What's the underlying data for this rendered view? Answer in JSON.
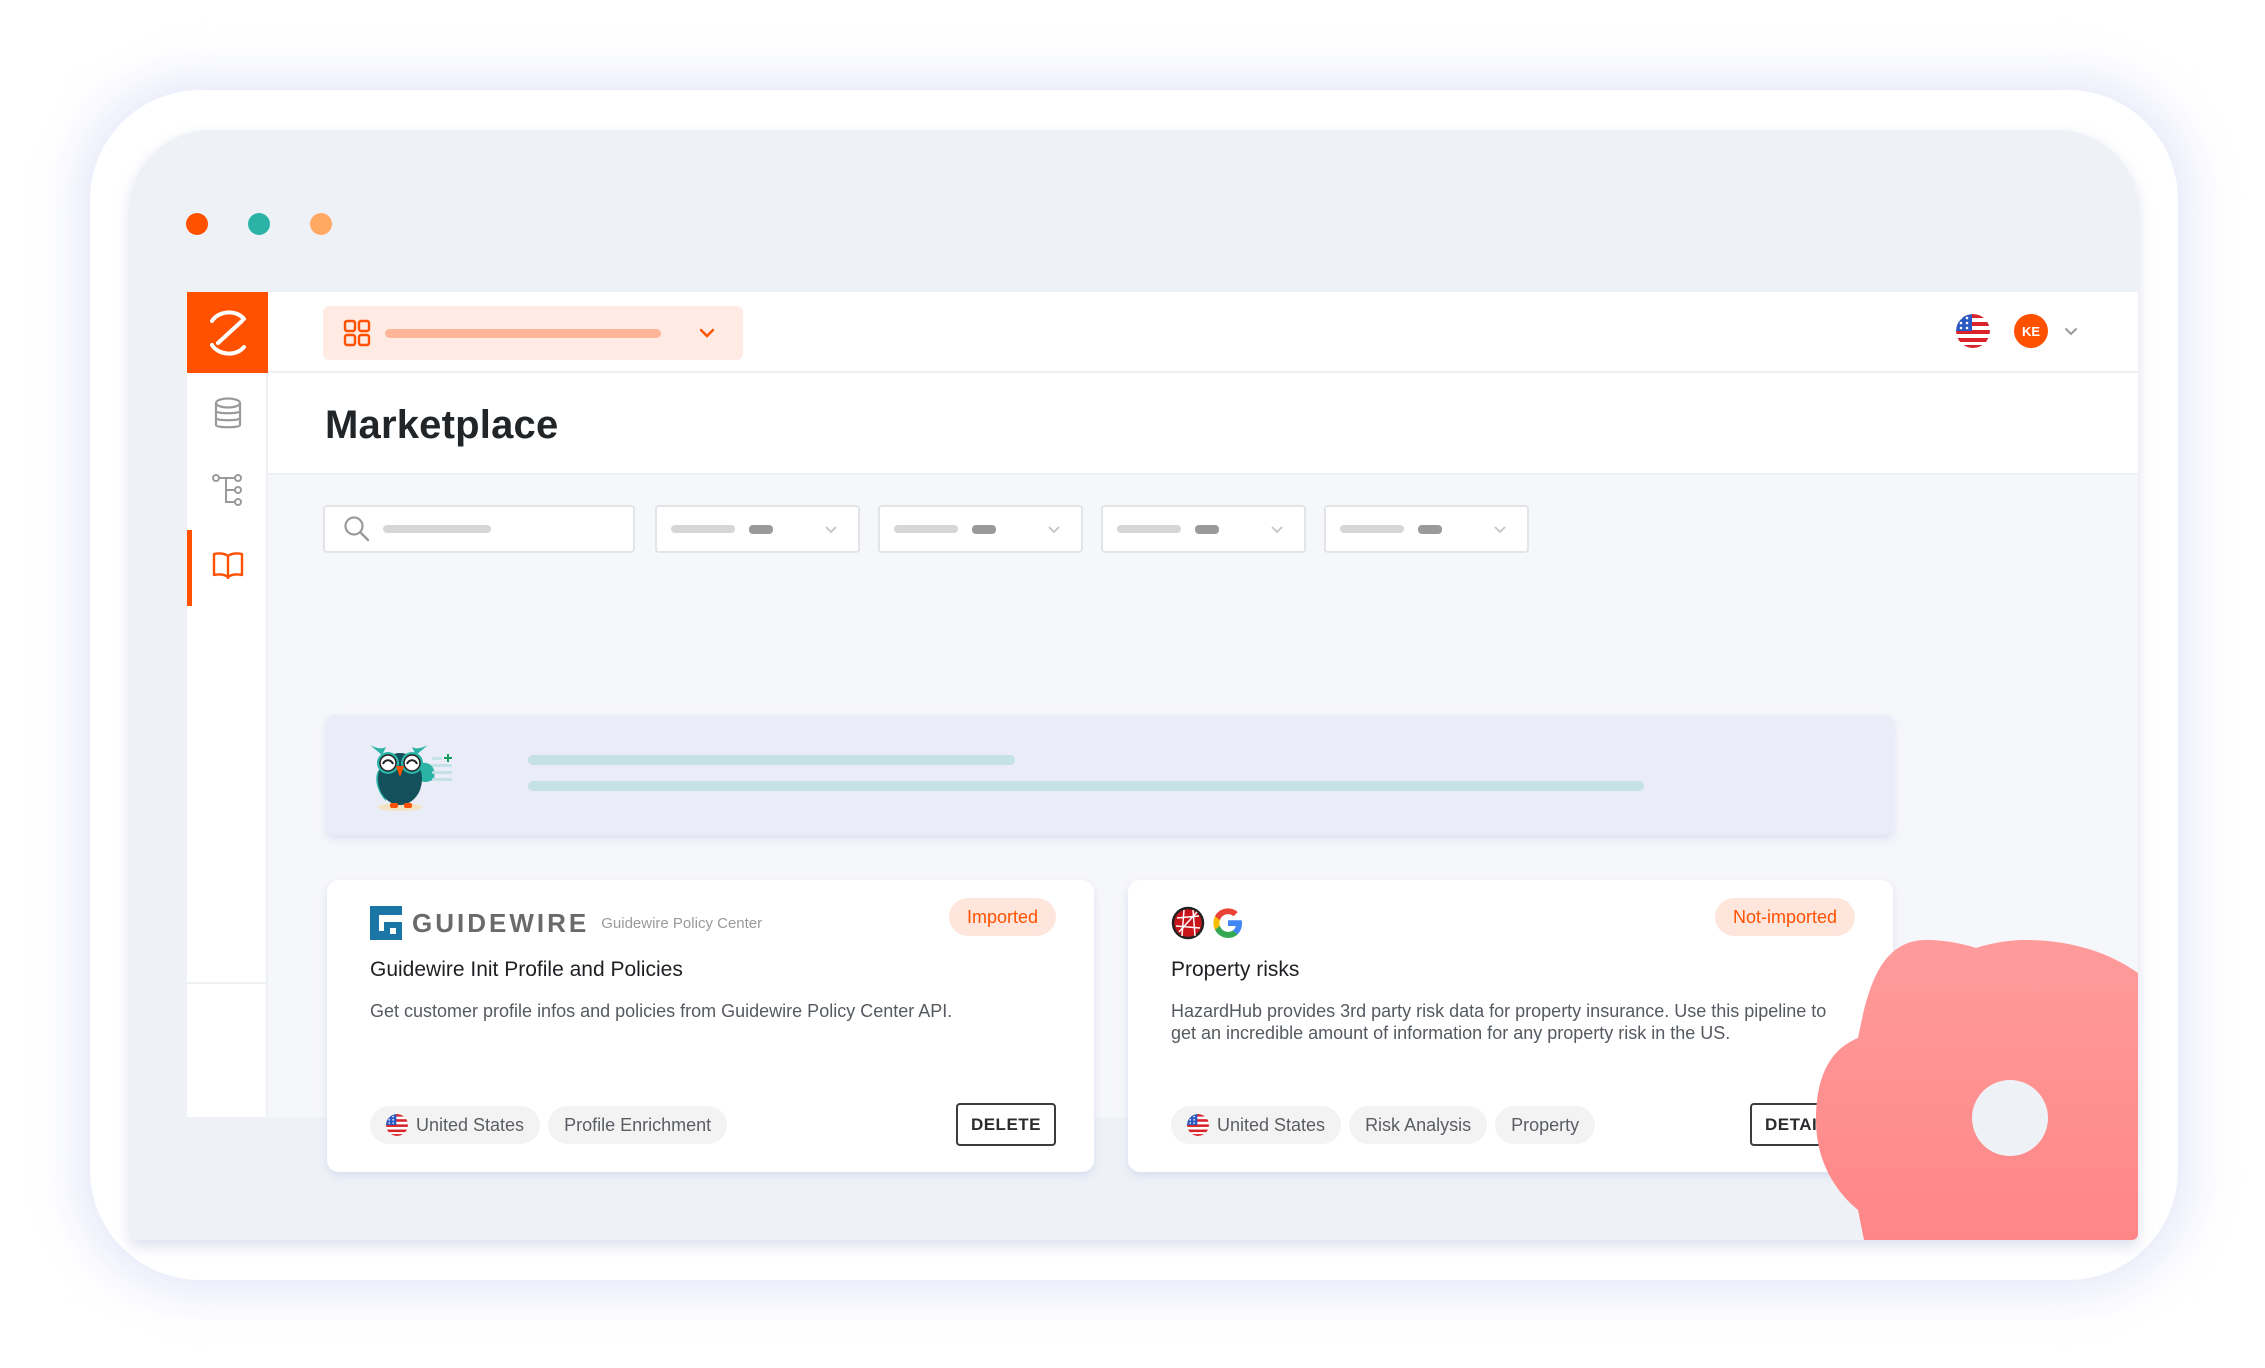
{
  "window": {
    "traffic_lights": [
      {
        "name": "close",
        "color": "#ff5100"
      },
      {
        "name": "minimize",
        "color": "#2bb3a6"
      },
      {
        "name": "maximize",
        "color": "#ffa963"
      }
    ]
  },
  "brand": {
    "accent": "#ff5100",
    "logo_icon": "zeta-logo-icon"
  },
  "sidebar": {
    "items": [
      {
        "id": "data",
        "icon": "database-icon",
        "active": false
      },
      {
        "id": "pipelines",
        "icon": "tree-icon",
        "active": false
      },
      {
        "id": "marketplace",
        "icon": "book-icon",
        "active": true
      }
    ]
  },
  "header": {
    "app_selector": {
      "icon": "grid-icon",
      "value": "",
      "chevron": "chevron-down-icon"
    },
    "language_flag": "us-flag-icon",
    "user": {
      "initials": "KE"
    }
  },
  "page": {
    "title": "Marketplace"
  },
  "filters": {
    "search": {
      "icon": "search-icon",
      "placeholder": ""
    },
    "dropdowns": [
      {
        "label": "",
        "value": ""
      },
      {
        "label": "",
        "value": ""
      },
      {
        "label": "",
        "value": ""
      },
      {
        "label": "",
        "value": ""
      }
    ]
  },
  "banner": {
    "illustration": "owl-mascot"
  },
  "cards": [
    {
      "logo_text": "GUIDEWIRE",
      "logo_subtext": "Guidewire Policy Center",
      "status": "Imported",
      "title": "Guidewire Init Profile and Policies",
      "description": "Get customer profile infos and policies from Guidewire Policy Center API.",
      "tags": [
        "United States",
        "Profile Enrichment"
      ],
      "action": "DELETE"
    },
    {
      "logo_icons": [
        "hazardhub-icon",
        "google-icon"
      ],
      "status": "Not-imported",
      "title": "Property risks",
      "description": "HazardHub provides 3rd party risk data for property insurance. Use this pipeline to get an incredible amount of information for any property risk in the US.",
      "tags": [
        "United States",
        "Risk Analysis",
        "Property"
      ],
      "action": "DETAILS"
    }
  ]
}
